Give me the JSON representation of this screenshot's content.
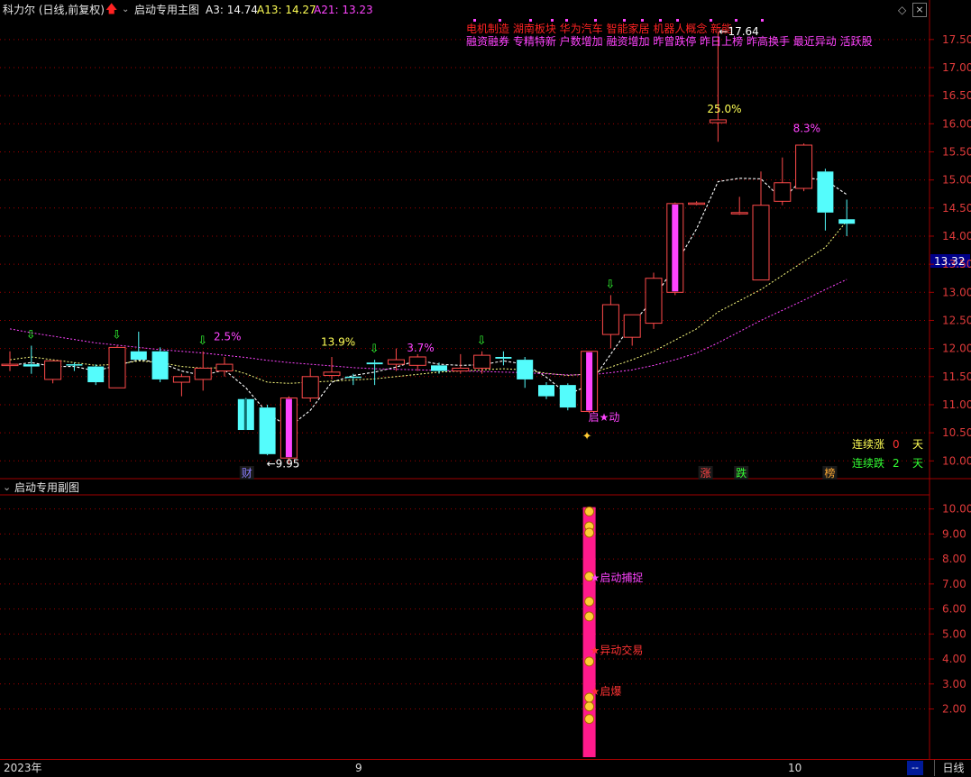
{
  "header": {
    "stock_title": "科力尔 (日线,前复权)",
    "indicator_name": "启动专用主图",
    "a3_label": "A3: 14.74",
    "a13_label": "A13: 14.27",
    "a21_label": "A21: 13.23"
  },
  "sub_header": {
    "indicator_name": "启动专用副图"
  },
  "concept_tags_line1": [
    "电机制造",
    "湖南板块",
    "华为汽车",
    "智能家居",
    "机器人概念",
    "新能"
  ],
  "concept_tags_line2": [
    "融资融券",
    "专精特新",
    "户数增加",
    "融资增加",
    "昨曾跌停",
    "昨日上榜",
    "昨高换手",
    "最近异动",
    "活跃股"
  ],
  "max_price_label": "17.64",
  "min_price_label": "9.95",
  "current_price_tag": "13.32",
  "pct_labels": [
    "2.5%",
    "13.9%",
    "3.7%",
    "25.0%",
    "8.3%"
  ],
  "start_label": "启★动",
  "bottom_markers": [
    "财",
    "涨",
    "跌",
    "榜"
  ],
  "streak": {
    "up_label": "连续涨",
    "up_days": "0",
    "up_unit": "天",
    "down_label": "连续跌",
    "down_days": "2",
    "down_unit": "天"
  },
  "sub_labels": [
    "★启动捕捉",
    "★异动交易",
    "★启爆"
  ],
  "x_axis": {
    "labels": [
      "2023年",
      "9",
      "10"
    ],
    "period_button": "日线",
    "nav_button": "--"
  },
  "colors": {
    "up": "#ff4a4a",
    "down": "#54fcfc",
    "ma_short": "#ffffff",
    "ma_mid": "#ffff80",
    "ma_long": "#ff44ff",
    "signal_bar": "#ff1a8c",
    "grid": "#a00000",
    "arrow": "#33ff33"
  },
  "chart_data": {
    "type": "candlestick",
    "y_axis_main": {
      "ylim": [
        9.7,
        17.85
      ],
      "ticks": [
        "17.50",
        "17.00",
        "16.50",
        "16.00",
        "15.50",
        "15.00",
        "14.50",
        "14.00",
        "13.50",
        "13.00",
        "12.50",
        "12.00",
        "11.50",
        "11.00",
        "10.50",
        "10.00"
      ]
    },
    "y_axis_sub": {
      "ylim": [
        0,
        10.6
      ],
      "ticks": [
        "10.00",
        "9.00",
        "8.00",
        "7.00",
        "6.00",
        "5.00",
        "4.00",
        "3.00",
        "2.00"
      ]
    },
    "candles": [
      {
        "o": 11.7,
        "h": 11.95,
        "l": 11.6,
        "c": 11.72
      },
      {
        "o": 11.72,
        "h": 12.05,
        "l": 11.55,
        "c": 11.68
      },
      {
        "o": 11.45,
        "h": 11.78,
        "l": 11.38,
        "c": 11.78
      },
      {
        "o": 11.72,
        "h": 11.75,
        "l": 11.6,
        "c": 11.7
      },
      {
        "o": 11.68,
        "h": 11.72,
        "l": 11.35,
        "c": 11.4
      },
      {
        "o": 11.3,
        "h": 12.05,
        "l": 11.3,
        "c": 12.02
      },
      {
        "o": 11.95,
        "h": 12.3,
        "l": 11.85,
        "c": 11.8
      },
      {
        "o": 11.95,
        "h": 12.02,
        "l": 11.4,
        "c": 11.45
      },
      {
        "o": 11.4,
        "h": 11.55,
        "l": 11.15,
        "c": 11.5
      },
      {
        "o": 11.45,
        "h": 11.95,
        "l": 11.25,
        "c": 11.65
      },
      {
        "o": 11.6,
        "h": 11.85,
        "l": 11.5,
        "c": 11.72
      },
      {
        "o": 11.1,
        "h": 11.12,
        "l": 10.55,
        "c": 10.55
      },
      {
        "o": 10.95,
        "h": 11.0,
        "l": 10.1,
        "c": 10.12
      },
      {
        "o": 10.05,
        "h": 11.15,
        "l": 9.95,
        "c": 11.12
      },
      {
        "o": 11.12,
        "h": 11.65,
        "l": 11.05,
        "c": 11.5
      },
      {
        "o": 11.52,
        "h": 11.85,
        "l": 11.45,
        "c": 11.58
      },
      {
        "o": 11.5,
        "h": 11.55,
        "l": 11.35,
        "c": 11.48
      },
      {
        "o": 11.75,
        "h": 11.8,
        "l": 11.35,
        "c": 11.72
      },
      {
        "o": 11.72,
        "h": 12.0,
        "l": 11.6,
        "c": 11.8
      },
      {
        "o": 11.7,
        "h": 11.9,
        "l": 11.6,
        "c": 11.85
      },
      {
        "o": 11.7,
        "h": 11.75,
        "l": 11.55,
        "c": 11.6
      },
      {
        "o": 11.6,
        "h": 11.9,
        "l": 11.55,
        "c": 11.65
      },
      {
        "o": 11.65,
        "h": 11.95,
        "l": 11.55,
        "c": 11.88
      },
      {
        "o": 11.85,
        "h": 11.95,
        "l": 11.7,
        "c": 11.82
      },
      {
        "o": 11.8,
        "h": 11.85,
        "l": 11.3,
        "c": 11.45
      },
      {
        "o": 11.35,
        "h": 11.4,
        "l": 11.1,
        "c": 11.15
      },
      {
        "o": 11.35,
        "h": 11.38,
        "l": 10.9,
        "c": 10.95
      },
      {
        "o": 10.88,
        "h": 11.95,
        "l": 10.85,
        "c": 11.95
      },
      {
        "o": 12.25,
        "h": 12.95,
        "l": 12.0,
        "c": 12.78
      },
      {
        "o": 12.2,
        "h": 12.6,
        "l": 12.05,
        "c": 12.6
      },
      {
        "o": 12.45,
        "h": 13.35,
        "l": 12.35,
        "c": 13.25
      },
      {
        "o": 13.0,
        "h": 14.6,
        "l": 12.95,
        "c": 14.58
      },
      {
        "o": 14.58,
        "h": 14.62,
        "l": 14.55,
        "c": 14.59
      },
      {
        "o": 16.02,
        "h": 17.64,
        "l": 15.68,
        "c": 16.07
      },
      {
        "o": 14.41,
        "h": 14.7,
        "l": 14.38,
        "c": 14.42
      },
      {
        "o": 13.22,
        "h": 15.15,
        "l": 13.22,
        "c": 14.55
      },
      {
        "o": 14.62,
        "h": 15.4,
        "l": 14.55,
        "c": 14.95
      },
      {
        "o": 14.85,
        "h": 15.65,
        "l": 14.8,
        "c": 15.62
      },
      {
        "o": 15.15,
        "h": 15.2,
        "l": 14.1,
        "c": 14.42
      },
      {
        "o": 14.3,
        "h": 14.65,
        "l": 14.0,
        "c": 14.22
      }
    ],
    "signal_candles": [
      13,
      27,
      31
    ],
    "moving_averages": [
      {
        "name": "A3",
        "values": [
          11.7,
          11.75,
          11.68,
          11.68,
          11.6,
          11.7,
          11.8,
          11.75,
          11.6,
          11.52,
          11.62,
          11.3,
          10.85,
          10.6,
          10.9,
          11.4,
          11.52,
          11.58,
          11.67,
          11.79,
          11.72,
          11.7,
          11.71,
          11.78,
          11.72,
          11.49,
          11.18,
          11.35,
          11.9,
          12.44,
          12.88,
          13.48,
          14.13,
          14.97,
          15.03,
          15.02,
          14.65,
          15.04,
          15.0,
          14.74
        ]
      },
      {
        "name": "A13",
        "values": [
          11.8,
          11.85,
          11.8,
          11.75,
          11.7,
          11.72,
          11.78,
          11.75,
          11.68,
          11.65,
          11.66,
          11.55,
          11.4,
          11.38,
          11.4,
          11.42,
          11.44,
          11.46,
          11.5,
          11.54,
          11.58,
          11.6,
          11.62,
          11.64,
          11.62,
          11.56,
          11.52,
          11.55,
          11.67,
          11.8,
          11.95,
          12.15,
          12.35,
          12.65,
          12.85,
          13.05,
          13.3,
          13.55,
          13.8,
          14.27
        ]
      },
      {
        "name": "A21",
        "values": [
          12.35,
          12.28,
          12.22,
          12.16,
          12.1,
          12.06,
          12.02,
          11.98,
          11.95,
          11.92,
          11.88,
          11.84,
          11.79,
          11.75,
          11.72,
          11.69,
          11.66,
          11.64,
          11.63,
          11.62,
          11.61,
          11.6,
          11.59,
          11.58,
          11.57,
          11.55,
          11.53,
          11.53,
          11.57,
          11.62,
          11.7,
          11.8,
          11.92,
          12.1,
          12.3,
          12.5,
          12.68,
          12.86,
          13.05,
          13.23
        ]
      }
    ],
    "sub_signal_column": {
      "candle_index": 27,
      "top_value": 10.0
    },
    "sub_icon_values": [
      9.9,
      9.3,
      9.05,
      7.3,
      6.3,
      5.7,
      3.9,
      2.1,
      2.45,
      1.6
    ]
  }
}
